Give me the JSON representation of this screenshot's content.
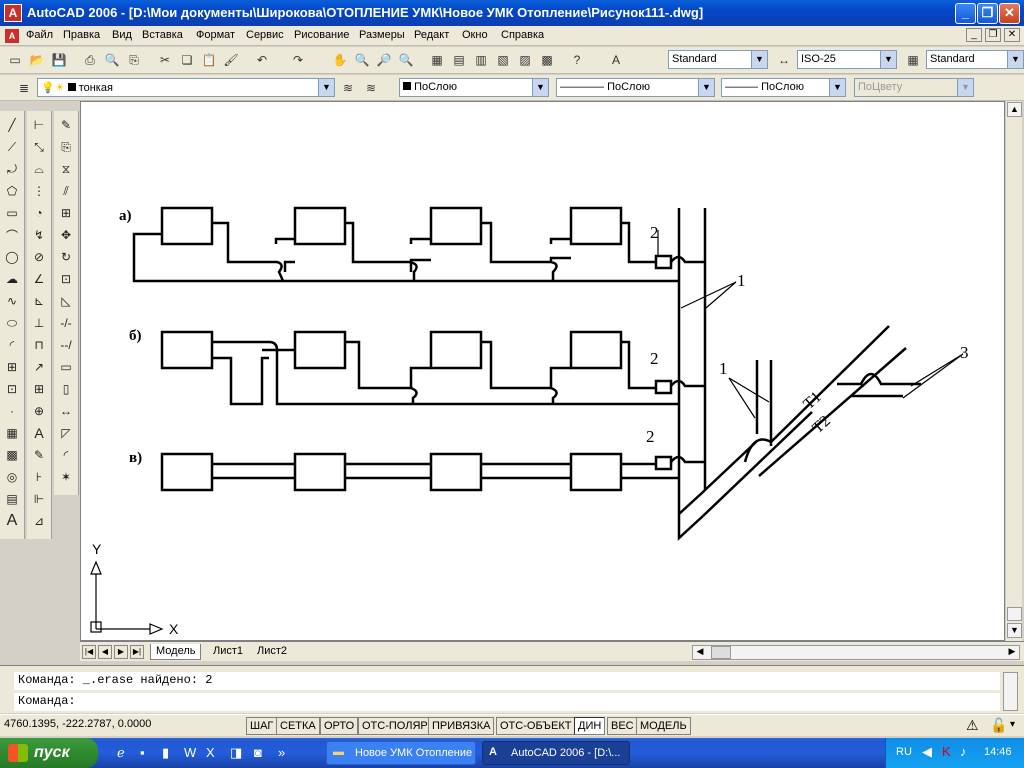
{
  "window": {
    "title": "AutoCAD 2006 - [D:\\Мои документы\\Широкова\\ОТОПЛЕНИЕ УМК\\Новое УМК Отопление\\Рисунок111-.dwg]",
    "app_icon_letter": "A"
  },
  "menu": {
    "items": [
      "Файл",
      "Правка",
      "Вид",
      "Вставка",
      "Формат",
      "Сервис",
      "Рисование",
      "Размеры",
      "Редакт",
      "Окно",
      "Справка"
    ]
  },
  "styles_toolbar": {
    "text_style": "Standard",
    "dim_style": "ISO-25",
    "table_style": "Standard"
  },
  "layers_toolbar": {
    "layer": "тонкая",
    "color": "ПоСлою",
    "linetype": "ПоСлою",
    "lineweight": "ПоСлою",
    "plotstyle": "ПоЦвету"
  },
  "drawing": {
    "labels": {
      "a": "а)",
      "b": "б)",
      "v": "в)",
      "n2a": "2",
      "n2b": "2",
      "n2c": "2",
      "n1a": "1",
      "n1b": "1",
      "n3": "3",
      "t1": "Т1",
      "t2": "Т2"
    },
    "ucs": {
      "x": "X",
      "y": "Y"
    }
  },
  "tabs": [
    "Модель",
    "Лист1",
    "Лист2"
  ],
  "command": {
    "line1": "Команда: _.erase найдено: 2",
    "line2": "Команда:"
  },
  "status": {
    "coords": "4760.1395, -222.2787, 0.0000",
    "buttons": [
      "ШАГ",
      "СЕТКА",
      "ОРТО",
      "ОТС-ПОЛЯР",
      "ПРИВЯЗКА",
      "ОТС-ОБЪЕКТ",
      "ДИН",
      "ВЕС",
      "МОДЕЛЬ"
    ]
  },
  "taskbar": {
    "start": "пуск",
    "items": [
      "Новое УМК Отопление",
      "AutoCAD 2006 - [D:\\..."
    ],
    "lang": "RU",
    "clock": "14:46"
  }
}
